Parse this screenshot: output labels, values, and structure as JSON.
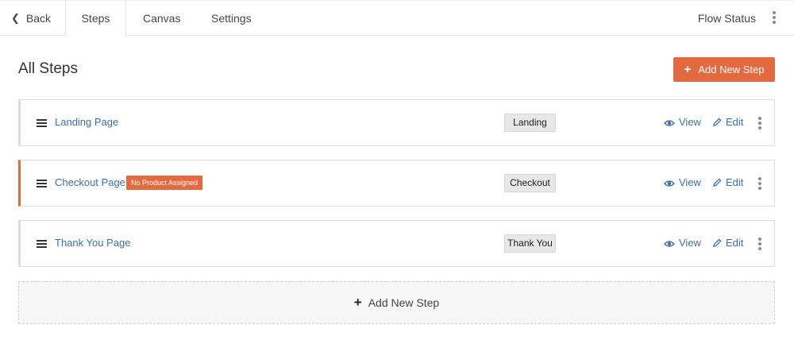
{
  "nav": {
    "back_label": "Back",
    "tabs": [
      "Steps",
      "Canvas",
      "Settings"
    ],
    "flow_status_label": "Flow Status"
  },
  "page": {
    "heading": "All Steps",
    "add_button_label": "Add New Step",
    "add_new_step_label": "Add New Step"
  },
  "steps": [
    {
      "name": "Landing Page",
      "type": "Landing",
      "badge": "",
      "view_label": "View",
      "edit_label": "Edit"
    },
    {
      "name": "Checkout Page",
      "type": "Checkout",
      "badge": "No Product Assigned",
      "view_label": "View",
      "edit_label": "Edit"
    },
    {
      "name": "Thank You Page",
      "type": "Thank You",
      "badge": "",
      "view_label": "View",
      "edit_label": "Edit"
    }
  ],
  "colors": {
    "accent": "#e3693f",
    "link": "#3d6fa5"
  },
  "icons": {
    "back": "chevron-left-icon",
    "more": "kebab-menu-icon",
    "drag": "drag-handle-icon",
    "view": "eye-icon",
    "edit": "pencil-icon",
    "add": "plus-icon"
  }
}
